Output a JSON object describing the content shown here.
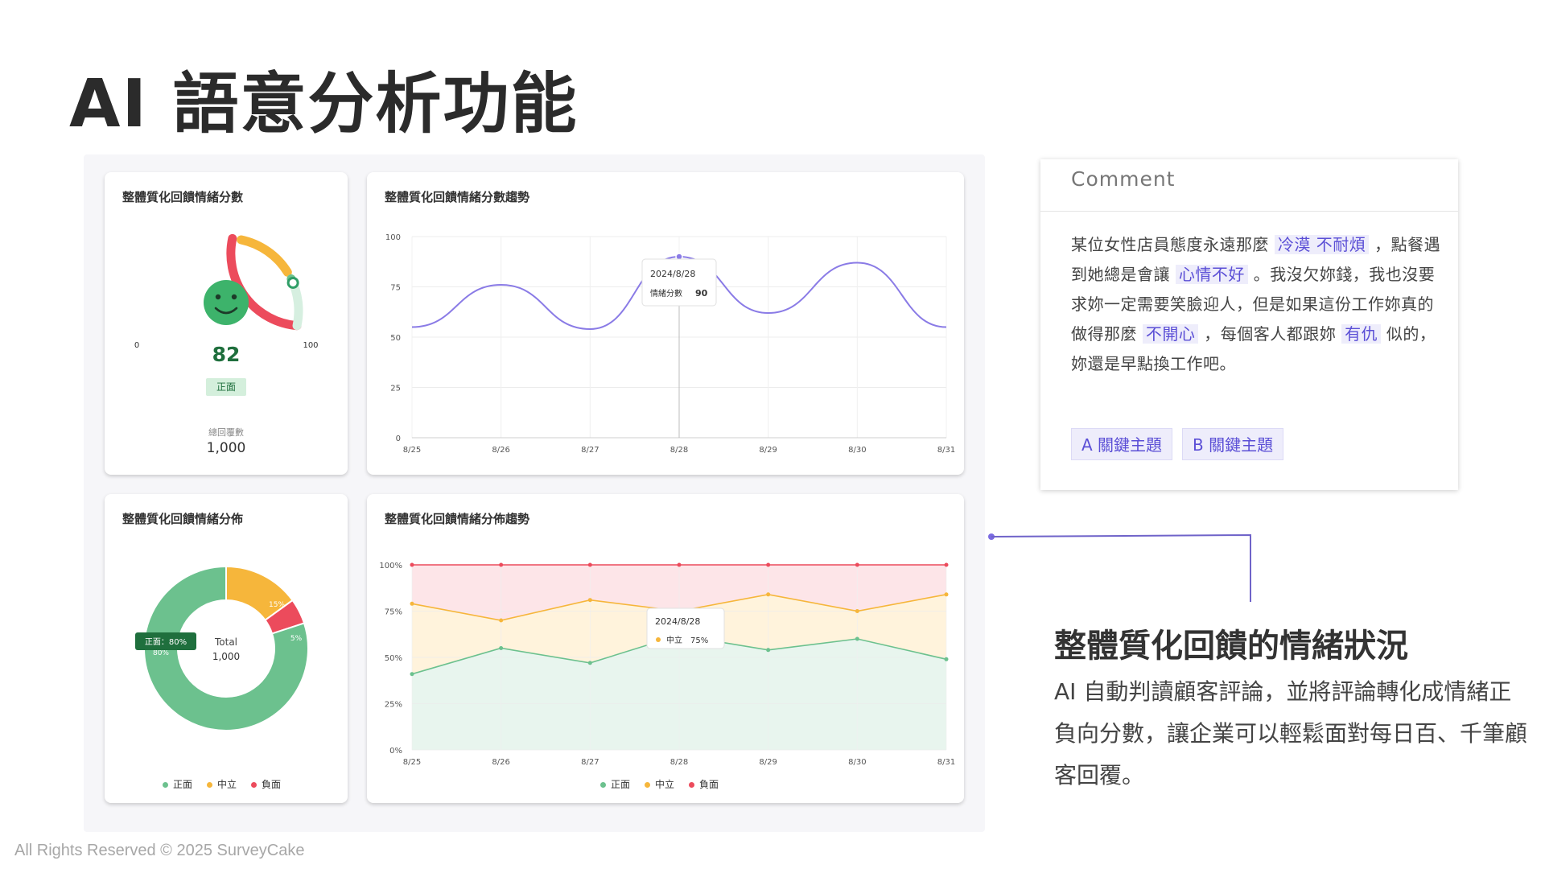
{
  "page": {
    "title": "AI 語意分析功能",
    "copyright": "All Rights Reserved © 2025 SurveyCake"
  },
  "colors": {
    "positive": "#6cc18e",
    "neutral": "#f6b63b",
    "negative": "#ec4b5c",
    "accent": "#7b6be2"
  },
  "score_card": {
    "title": "整體質化回饋情緒分數",
    "min_label": "0",
    "max_label": "100",
    "score": "82",
    "score_fraction": 0.82,
    "badge": "正面",
    "total_label": "總回覆數",
    "total_value": "1,000",
    "face_icon": "smiley-face-icon"
  },
  "trend_card": {
    "title": "整體質化回饋情緒分數趨勢",
    "tooltip_date": "2024/8/28",
    "tooltip_label": "情緒分數",
    "tooltip_value": "90"
  },
  "dist_card": {
    "title": "整體質化回饋情緒分佈",
    "center_label": "Total",
    "center_value": "1,000",
    "tooltip": "正面：80%",
    "label_positive": "80%",
    "label_neutral": "15%",
    "label_negative": "5%",
    "legend": [
      "正面",
      "中立",
      "負面"
    ]
  },
  "dtrend_card": {
    "title": "整體質化回饋情緒分佈趨勢",
    "tooltip_date": "2024/8/28",
    "tooltip_label": "中立",
    "tooltip_value": "75%",
    "legend": [
      "正面",
      "中立",
      "負面"
    ]
  },
  "chart_data": [
    {
      "type": "pie",
      "title": "整體質化回饋情緒分佈",
      "categories": [
        "正面",
        "中立",
        "負面"
      ],
      "values": [
        80,
        15,
        5
      ],
      "legend": "bottom"
    },
    {
      "type": "line",
      "title": "整體質化回饋情緒分數趨勢",
      "x": [
        "8/25",
        "8/26",
        "8/27",
        "8/28",
        "8/29",
        "8/30",
        "8/31"
      ],
      "y_ticks": [
        "0",
        "25",
        "50",
        "75",
        "100"
      ],
      "ylim": [
        0,
        100
      ],
      "grid": true,
      "series": [
        {
          "values": [
            55,
            76,
            54,
            90,
            62,
            87,
            55
          ]
        }
      ]
    },
    {
      "type": "area",
      "title": "整體質化回饋情緒分佈趨勢",
      "x": [
        "8/25",
        "8/26",
        "8/27",
        "8/28",
        "8/29",
        "8/30",
        "8/31"
      ],
      "y_ticks": [
        "0%",
        "25%",
        "50%",
        "75%",
        "100%"
      ],
      "ylim": [
        0,
        100
      ],
      "grid": true,
      "legend": "bottom",
      "series": [
        {
          "name": "正面",
          "values": [
            41,
            55,
            47,
            62,
            54,
            60,
            49
          ]
        },
        {
          "name": "中立",
          "values": [
            79,
            70,
            81,
            75,
            84,
            75,
            84
          ]
        },
        {
          "name": "負面",
          "values": [
            100,
            100,
            100,
            100,
            100,
            100,
            100
          ]
        }
      ]
    }
  ],
  "comment": {
    "header": "Comment",
    "segments": [
      {
        "text": "某位女性店員態度永遠那麼 ",
        "hl": false
      },
      {
        "text": "冷漠 不耐煩",
        "hl": true
      },
      {
        "text": " ，點餐遇到她總是會讓 ",
        "hl": false
      },
      {
        "text": "心情不好",
        "hl": true
      },
      {
        "text": " 。我沒欠妳錢，我也沒要求妳一定需要笑臉迎人，但是如果這份工作妳真的做得那麼 ",
        "hl": false
      },
      {
        "text": "不開心",
        "hl": true
      },
      {
        "text": " ，每個客人都跟妳 ",
        "hl": false
      },
      {
        "text": "有仇",
        "hl": true
      },
      {
        "text": " 似的，妳還是早點換工作吧。",
        "hl": false
      }
    ],
    "tag_a": "A 關鍵主題",
    "tag_b": "B 關鍵主題"
  },
  "section": {
    "heading": "整體質化回饋的情緒狀況",
    "description": "AI 自動判讀顧客評論，並將評論轉化成情緒正負向分數，讓企業可以輕鬆面對每日百、千筆顧客回覆。"
  }
}
